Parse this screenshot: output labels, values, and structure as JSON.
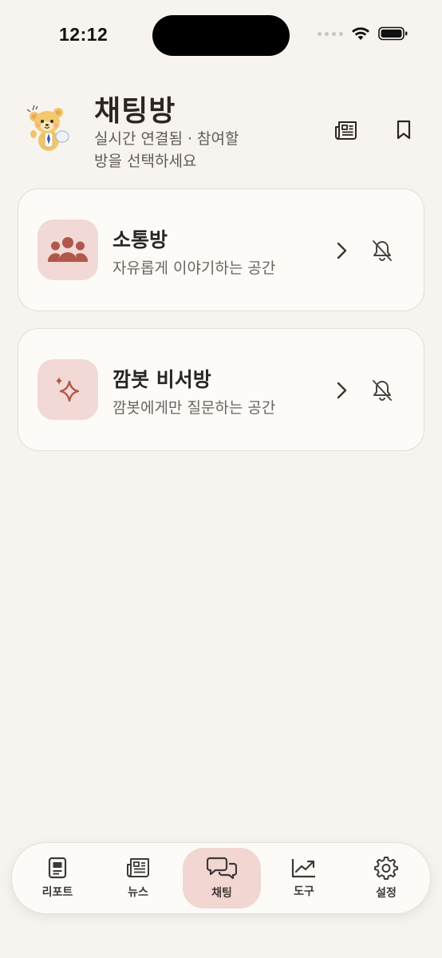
{
  "status_bar": {
    "time": "12:12"
  },
  "header": {
    "title": "채팅방",
    "subtitle": "실시간 연결됨 · 참여할 방을 선택하세요",
    "actions": [
      {
        "icon": "newspaper-icon"
      },
      {
        "icon": "bookmark-icon"
      }
    ]
  },
  "rooms": [
    {
      "title": "소통방",
      "description": "자유롭게 이야기하는 공간",
      "icon": "people-group-icon"
    },
    {
      "title": "깜봇 비서방",
      "description": "깜봇에게만 질문하는 공간",
      "icon": "sparkle-icon"
    }
  ],
  "tabs": [
    {
      "label": "리포트",
      "icon": "report-icon",
      "active": false
    },
    {
      "label": "뉴스",
      "icon": "newspaper-icon",
      "active": false
    },
    {
      "label": "채팅",
      "icon": "chat-bubbles-icon",
      "active": true
    },
    {
      "label": "도구",
      "icon": "trend-chart-icon",
      "active": false
    },
    {
      "label": "설정",
      "icon": "gear-icon",
      "active": false
    }
  ],
  "colors": {
    "background": "#f7f4ef",
    "card": "#fcfbf8",
    "accent_tile": "#f2d9d5",
    "accent_icon": "#b0574b",
    "active_tab": "#f1d6d1"
  }
}
